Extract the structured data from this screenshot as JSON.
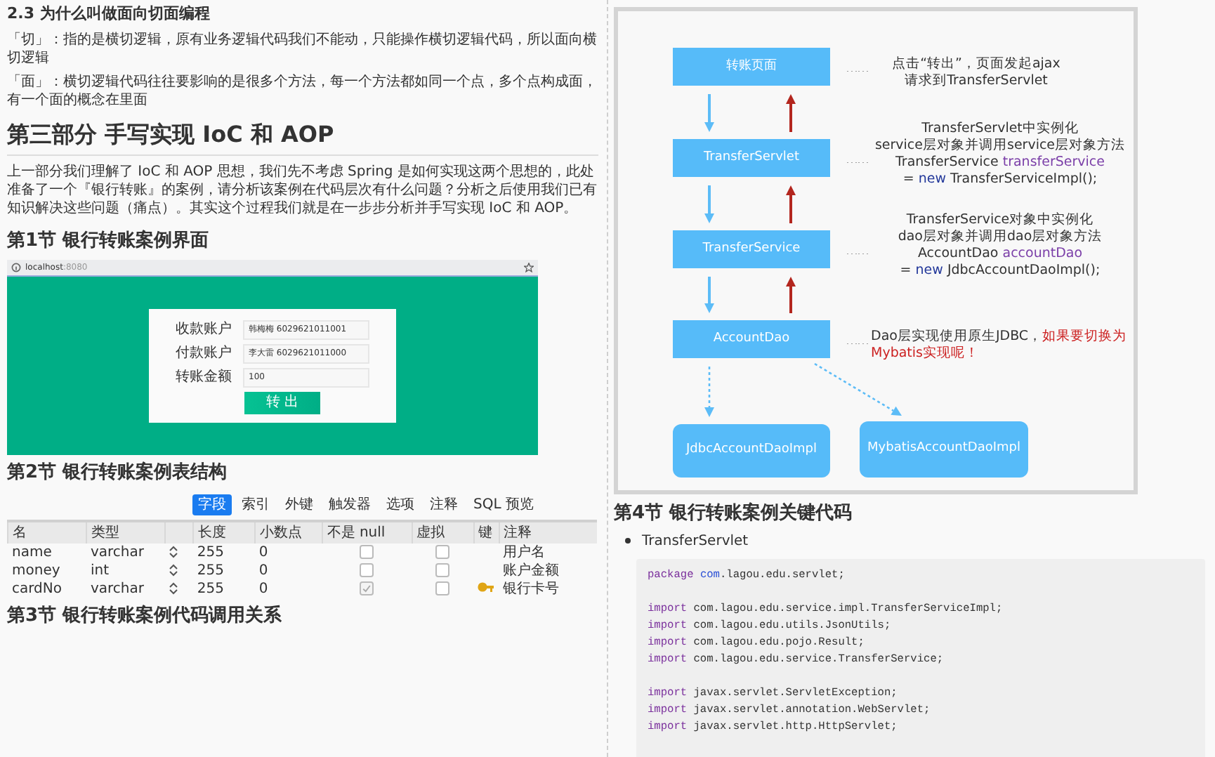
{
  "left_page": {
    "section_heading": "2.3 为什么叫做面向切面编程",
    "paragraphs": [
      "「切」：指的是横切逻辑，原有业务逻辑代码我们不能动，只能操作横切逻辑代码，所以面向横切逻辑",
      "「面」：横切逻辑代码往往要影响的是很多个方法，每一个方法都如同一个点，多个点构成面，有一个面的概念在里面"
    ],
    "part_title": "第三部分 手写实现 IoC 和 AOP",
    "intro": "上一部分我们理解了 IoC 和 AOP 思想，我们先不考虑 Spring 是如何实现这两个思想的，此处准备了一个『银行转账』的案例，请分析该案例在代码层次有什么问题？分析之后使用我们已有知识解决这些问题（痛点）。其实这个过程我们就是在一步步分析并手写实现 IoC 和 AOP。",
    "section_1": {
      "title": "第1节 银行转账案例界面",
      "screenshot": {
        "url_host": "localhost",
        "url_port": ":8080",
        "fields": [
          {
            "label": "收款账户",
            "value": "韩梅梅 6029621011001"
          },
          {
            "label": "付款账户",
            "value": "李大雷 6029621011000"
          },
          {
            "label": "转账金额",
            "value": "100"
          }
        ],
        "button": "转 出"
      }
    },
    "section_2": {
      "title": "第2节 银行转账案例表结构",
      "tabs": [
        {
          "label": "字段",
          "selected": true
        },
        {
          "label": "索引",
          "selected": false
        },
        {
          "label": "外键",
          "selected": false
        },
        {
          "label": "触发器",
          "selected": false
        },
        {
          "label": "选项",
          "selected": false
        },
        {
          "label": "注释",
          "selected": false
        },
        {
          "label": "SQL 预览",
          "selected": false
        }
      ],
      "columns": [
        "名",
        "类型",
        "长度",
        "小数点",
        "不是 null",
        "虚拟",
        "键",
        "注释"
      ],
      "rows": [
        {
          "name": "name",
          "type": "varchar",
          "length": "255",
          "decimals": "0",
          "not_null": false,
          "virtual": false,
          "key": false,
          "comment": "用户名"
        },
        {
          "name": "money",
          "type": "int",
          "length": "255",
          "decimals": "0",
          "not_null": false,
          "virtual": false,
          "key": false,
          "comment": "账户金额"
        },
        {
          "name": "cardNo",
          "type": "varchar",
          "length": "255",
          "decimals": "0",
          "not_null": true,
          "virtual": false,
          "key": true,
          "comment": "银行卡号"
        }
      ]
    },
    "section_3": {
      "title": "第3节 银行转账案例代码调用关系"
    }
  },
  "right_page": {
    "diagram": {
      "nodes": [
        {
          "label": "转账页面",
          "kind": "rect"
        },
        {
          "label": "TransferServlet",
          "kind": "rect"
        },
        {
          "label": "TransferService",
          "kind": "rect"
        },
        {
          "label": "AccountDao",
          "kind": "rect"
        },
        {
          "label": "JdbcAccountDaoImpl",
          "kind": "rounded"
        },
        {
          "label": "MybatisAccountDaoImpl",
          "kind": "rounded"
        }
      ],
      "notes": [
        {
          "leader": "……",
          "lines": [
            [
              {
                "text": "点击“转出”，页面发起ajax",
                "kind": "plain"
              }
            ],
            [
              {
                "text": "请求到TransferServlet",
                "kind": "plain"
              }
            ]
          ]
        },
        {
          "leader": "……",
          "lines": [
            [
              {
                "text": "TransferServlet中实例化",
                "kind": "plain"
              }
            ],
            [
              {
                "text": "service层对象并调用service层对象方法",
                "kind": "plain"
              }
            ],
            [
              {
                "text": "TransferService ",
                "kind": "plain"
              },
              {
                "text": "transferService",
                "kind": "var"
              }
            ],
            [
              {
                "text": "= ",
                "kind": "plain"
              },
              {
                "text": "new",
                "kind": "kw"
              },
              {
                "text": " TransferServiceImpl();",
                "kind": "plain"
              }
            ]
          ]
        },
        {
          "leader": "……",
          "lines": [
            [
              {
                "text": "TransferService对象中实例化",
                "kind": "plain"
              }
            ],
            [
              {
                "text": "dao层对象并调用dao层对象方法",
                "kind": "plain"
              }
            ],
            [
              {
                "text": "AccountDao ",
                "kind": "plain"
              },
              {
                "text": "accountDao",
                "kind": "var"
              }
            ],
            [
              {
                "text": "= ",
                "kind": "plain"
              },
              {
                "text": "new",
                "kind": "kw"
              },
              {
                "text": " JdbcAccountDaoImpl();",
                "kind": "plain"
              }
            ]
          ]
        },
        {
          "leader": "……",
          "lines": [
            [
              {
                "text": "Dao层实现使用原生JDBC，",
                "kind": "plain"
              },
              {
                "text": "如果要切换为",
                "kind": "warn"
              }
            ],
            [
              {
                "text": "Mybatis实现呢！",
                "kind": "warn"
              }
            ]
          ]
        }
      ]
    },
    "section_4": {
      "title": "第4节 银行转账案例关键代码",
      "bullet": "TransferServlet",
      "code": [
        [
          [
            {
              "text": "package",
              "kind": "kw"
            },
            {
              "text": " com",
              "kind": "ns"
            },
            {
              "text": ".lagou.edu.servlet;",
              "kind": "plain"
            }
          ]
        ],
        [
          [
            {
              "text": "import",
              "kind": "kw"
            },
            {
              "text": " com.lagou.edu.service.impl.TransferServiceImpl;",
              "kind": "plain"
            }
          ],
          [
            {
              "text": "import",
              "kind": "kw"
            },
            {
              "text": " com.lagou.edu.utils.JsonUtils;",
              "kind": "plain"
            }
          ],
          [
            {
              "text": "import",
              "kind": "kw"
            },
            {
              "text": " com.lagou.edu.pojo.Result;",
              "kind": "plain"
            }
          ],
          [
            {
              "text": "import",
              "kind": "kw"
            },
            {
              "text": " com.lagou.edu.service.TransferService;",
              "kind": "plain"
            }
          ]
        ],
        [
          [
            {
              "text": "import",
              "kind": "kw"
            },
            {
              "text": " javax.servlet.ServletException;",
              "kind": "plain"
            }
          ],
          [
            {
              "text": "import",
              "kind": "kw"
            },
            {
              "text": " javax.servlet.annotation.WebServlet;",
              "kind": "plain"
            }
          ],
          [
            {
              "text": "import",
              "kind": "kw"
            },
            {
              "text": " javax.servlet.http.HttpServlet;",
              "kind": "plain"
            }
          ]
        ]
      ]
    }
  }
}
